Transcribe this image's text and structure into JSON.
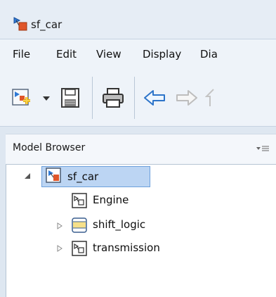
{
  "window": {
    "title": "sf_car",
    "title_icon": "simulink-model-icon"
  },
  "menubar": {
    "items": [
      "File",
      "Edit",
      "View",
      "Display",
      "Dia"
    ]
  },
  "toolbar": {
    "icons": [
      "new-model-icon",
      "dropdown-arrow-icon",
      "save-icon",
      "print-icon",
      "back-arrow-icon",
      "forward-arrow-icon",
      "up-arrow-icon"
    ]
  },
  "model_browser": {
    "title": "Model Browser",
    "menu_icon": "panel-menu-icon",
    "tree": [
      {
        "label": "sf_car",
        "icon": "simulink-model-icon",
        "expanded": true,
        "selected": true
      },
      {
        "label": "Engine",
        "icon": "subsystem-icon",
        "expandable": false
      },
      {
        "label": "shift_logic",
        "icon": "stateflow-chart-icon",
        "expandable": true
      },
      {
        "label": "transmission",
        "icon": "subsystem-icon",
        "expandable": true
      }
    ]
  },
  "colors": {
    "selection_bg": "#bcd5f3",
    "selection_border": "#6da0dc",
    "chrome_bg": "#dee7f1"
  }
}
